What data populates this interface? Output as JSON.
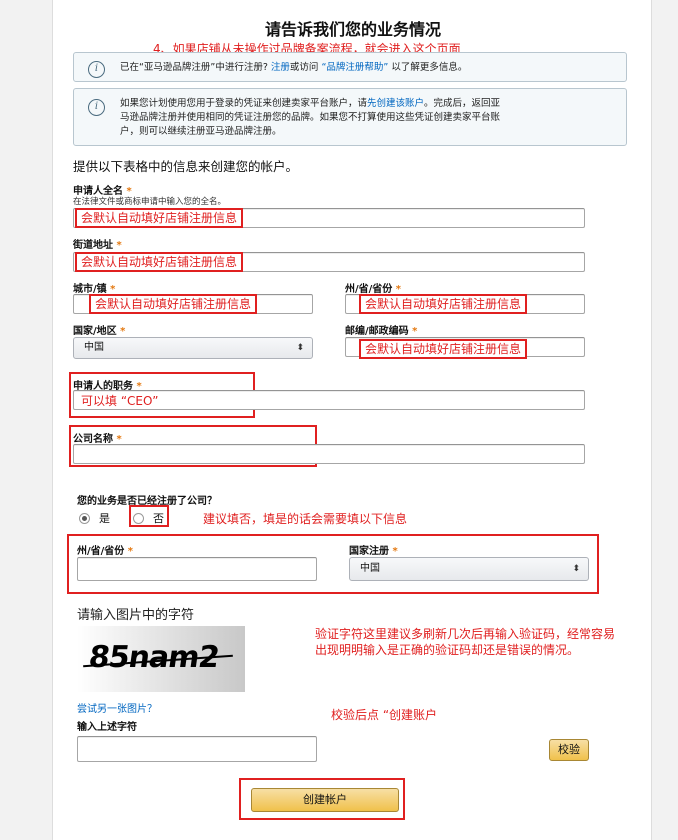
{
  "header": {
    "title": "请告诉我们您的业务情况",
    "annotation": "4、如果店铺从未操作过品牌备案流程，就会进入这个页面"
  },
  "notice1": {
    "text_before": "已在“亚马逊品牌注册”中进行注册? ",
    "link1": "注册",
    "text_mid": "或访问 ",
    "link2": "“品牌注册帮助”",
    "text_after": " 以了解更多信息。"
  },
  "notice2": {
    "line1_before": "如果您计划使用您用于登录的凭证来创建卖家平台账户，请",
    "link": "先创建该账户",
    "line1_after": "。完成后，返回亚",
    "line2": "马逊品牌注册并使用相同的凭证注册您的品牌。如果您不打算使用这些凭证创建卖家平台账",
    "line3": "户，则可以继续注册亚马逊品牌注册。"
  },
  "form_heading": "提供以下表格中的信息来创建您的帐户。",
  "fields": {
    "applicant_name": {
      "label": "申请人全名",
      "required": "*",
      "hint": "在法律文件或商标申请中输入您的全名。",
      "note": "会默认自动填好店铺注册信息"
    },
    "street": {
      "label": "街道地址",
      "required": "*",
      "note": "会默认自动填好店铺注册信息"
    },
    "city": {
      "label": "城市/镇",
      "required": "*",
      "note": "会默认自动填好店铺注册信息"
    },
    "state": {
      "label": "州/省/省份",
      "required": "*",
      "note": "会默认自动填好店铺注册信息"
    },
    "country": {
      "label": "国家/地区",
      "required": "*",
      "value": "中国"
    },
    "postal": {
      "label": "邮编/邮政编码",
      "required": "*",
      "note": "会默认自动填好店铺注册信息"
    },
    "title_role": {
      "label": "申请人的职务",
      "required": "*",
      "note": "可以填 “CEO”"
    },
    "company": {
      "label": "公司名称",
      "required": "*"
    }
  },
  "registered": {
    "question": "您的业务是否已经注册了公司？",
    "yes": "是",
    "no": "否",
    "note": "建议填否，填是的话会需要填以下信息"
  },
  "company_reg": {
    "state_label": "州/省/省份",
    "country_label": "国家注册",
    "required": "*",
    "country_value": "中国"
  },
  "captcha": {
    "heading": "请输入图片中的字符",
    "image_text": "85nam2",
    "note": "验证字符这里建议多刷新几次后再输入验证码，经常容易出现明明输入是正确的验证码却还是错误的情况。",
    "retry_link": "尝试另一张图片？",
    "input_label": "输入上述字符",
    "verify_button": "校验",
    "verify_note": "校验后点 “创建账户"
  },
  "submit": {
    "label": "创建帐户"
  },
  "icons": {
    "info": "info-icon",
    "select_arrow": "select-arrows-icon"
  },
  "colors": {
    "annotation_red": "#e02020",
    "link_blue": "#0066c0",
    "button_yellow": "#f0c14b",
    "required_orange": "#e47911"
  }
}
